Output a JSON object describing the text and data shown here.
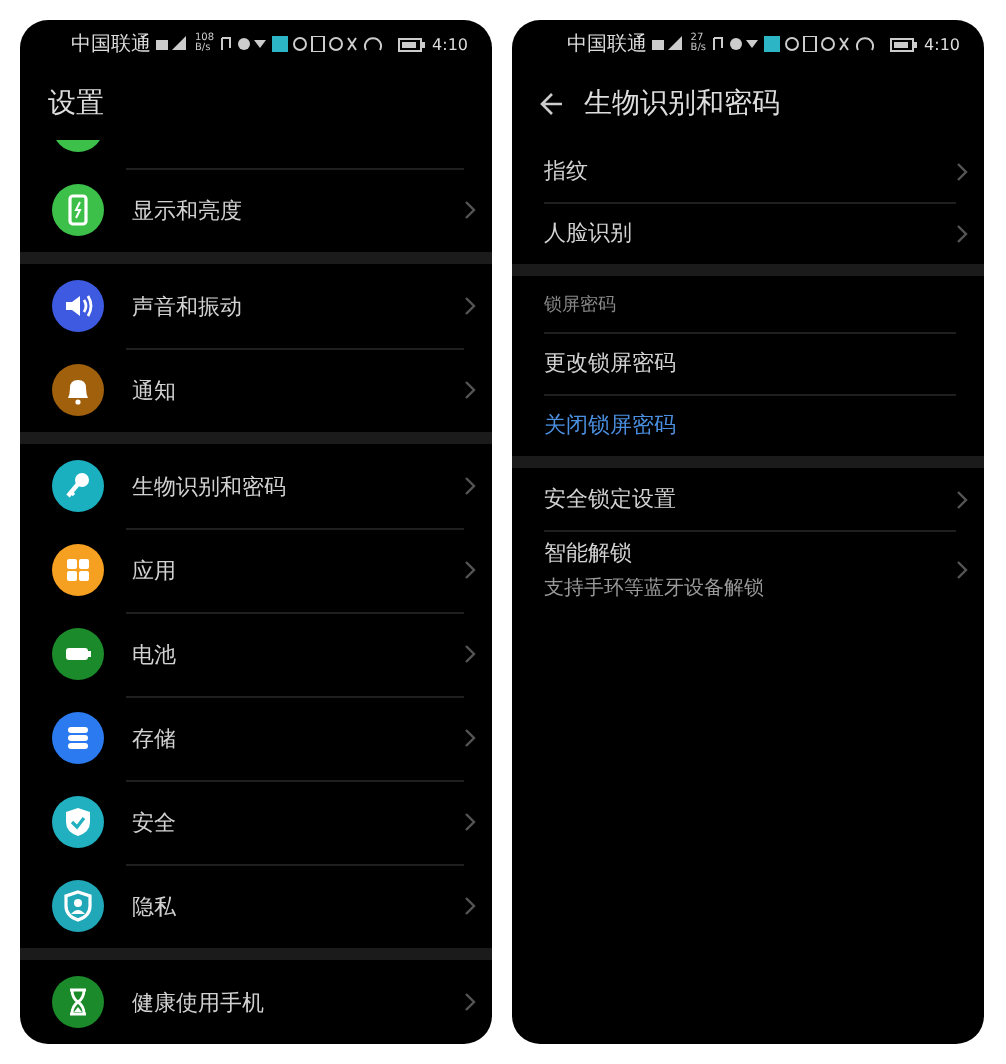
{
  "screens": [
    {
      "status_bar": {
        "carrier": "中国联通",
        "speed_value": "108",
        "speed_unit": "B/s",
        "time": "4:10"
      },
      "title": "设置",
      "back": false,
      "groups": [
        {
          "items": [
            {
              "kind": "cut",
              "color": "#3cc04a"
            },
            {
              "label": "显示和亮度",
              "kind": "icon",
              "color": "#3cc04a"
            }
          ]
        },
        {
          "items": [
            {
              "label": "声音和振动",
              "kind": "icon",
              "color": "#3d5ae0"
            },
            {
              "label": "通知",
              "kind": "icon",
              "color": "#a0600c"
            }
          ]
        },
        {
          "items": [
            {
              "label": "生物识别和密码",
              "kind": "icon",
              "color": "#1ab0c0"
            },
            {
              "label": "应用",
              "kind": "icon",
              "color": "#f5a020"
            },
            {
              "label": "电池",
              "kind": "icon",
              "color": "#1a8a2a"
            },
            {
              "label": "存储",
              "kind": "icon",
              "color": "#2b7af0"
            },
            {
              "label": "安全",
              "kind": "icon",
              "color": "#20b0c0"
            },
            {
              "label": "隐私",
              "kind": "icon",
              "color": "#20a8b8"
            }
          ]
        },
        {
          "items": [
            {
              "label": "健康使用手机",
              "kind": "icon",
              "color": "#1a8a2a"
            }
          ]
        }
      ]
    },
    {
      "status_bar": {
        "carrier": "中国联通",
        "speed_value": "27",
        "speed_unit": "B/s",
        "time": "4:10"
      },
      "title": "生物识别和密码",
      "back": true,
      "groups": [
        {
          "items": [
            {
              "label": "指纹",
              "kind": "link"
            },
            {
              "label": "人脸识别",
              "kind": "link"
            }
          ]
        },
        {
          "items": [
            {
              "label": "锁屏密码",
              "kind": "section"
            },
            {
              "label": "更改锁屏密码",
              "kind": "plain"
            },
            {
              "label": "关闭锁屏密码",
              "kind": "action"
            }
          ]
        },
        {
          "items": [
            {
              "label": "安全锁定设置",
              "kind": "link"
            },
            {
              "label": "智能解锁",
              "subtitle": "支持手环等蓝牙设备解锁",
              "kind": "link"
            }
          ]
        }
      ]
    }
  ]
}
